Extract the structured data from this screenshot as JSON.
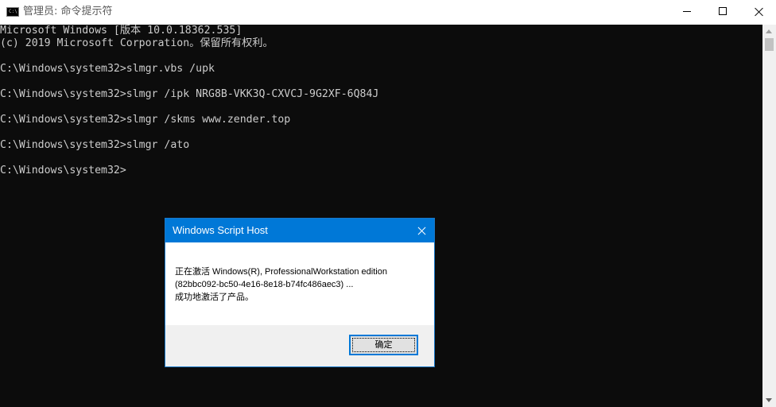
{
  "window": {
    "title": "管理员: 命令提示符",
    "icon": "cmd-icon",
    "controls": {
      "minimize": "minimize-icon",
      "maximize": "maximize-icon",
      "close": "close-icon"
    }
  },
  "console": {
    "lines": [
      "Microsoft Windows [版本 10.0.18362.535]",
      "(c) 2019 Microsoft Corporation。保留所有权利。",
      "",
      "C:\\Windows\\system32>slmgr.vbs /upk",
      "",
      "C:\\Windows\\system32>slmgr /ipk NRG8B-VKK3Q-CXVCJ-9G2XF-6Q84J",
      "",
      "C:\\Windows\\system32>slmgr /skms www.zender.top",
      "",
      "C:\\Windows\\system32>slmgr /ato",
      "",
      "C:\\Windows\\system32>"
    ],
    "background": "#0c0c0c",
    "foreground": "#cccccc"
  },
  "dialog": {
    "title": "Windows Script Host",
    "close_icon": "close-icon",
    "message_lines": [
      "正在激活 Windows(R), ProfessionalWorkstation edition",
      "(82bbc092-bc50-4e16-8e18-b74fc486aec3) ...",
      "成功地激活了产品。"
    ],
    "ok_label": "确定",
    "accent": "#0078d7"
  }
}
